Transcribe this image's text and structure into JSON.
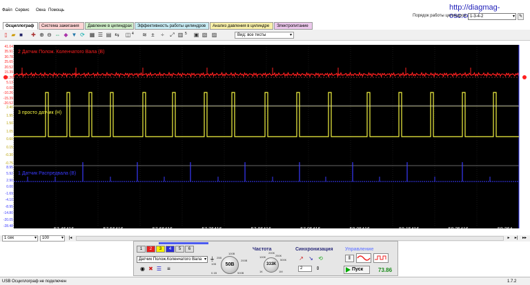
{
  "menu": [
    "Файл",
    "Сервис",
    "Окна",
    "Помощь"
  ],
  "url": "http://diagmag-osc.com/",
  "order": {
    "label": "Порядок работы цилиндров:",
    "value": "1-3-4-2"
  },
  "tabs": [
    {
      "label": "Осциллограф",
      "color": "#ffffff"
    },
    {
      "label": "Система зажигания",
      "color": "#ffd4d4"
    },
    {
      "label": "Давление в цилиндрах",
      "color": "#cfeec8"
    },
    {
      "label": "Эффективность работы цилиндров",
      "color": "#c8ecf4"
    },
    {
      "label": "Анализ давления в цилиндре",
      "color": "#f8f0a8"
    },
    {
      "label": "Электропитание",
      "color": "#ecc8ec"
    }
  ],
  "toolbar": {
    "counter1": "4",
    "counter2": "5",
    "view_select": "Вид: все тесты"
  },
  "channels": [
    {
      "label": "2 Датчик Полож. Коленчатого Вала (В)",
      "color": "#ff2020",
      "yticks": [
        "41.04",
        "35.91",
        "30.78",
        "25.65",
        "20.52",
        "15.39",
        "10.26",
        "5.13",
        "0.00",
        "-10.26",
        "-15.39",
        "-20.52"
      ]
    },
    {
      "label": "3 просто датчик (Н)",
      "color": "#f5f542",
      "yticks": [
        "2.40",
        "1.95",
        "1.50",
        "1.05",
        "0.60",
        "0.15",
        "-0.30",
        "-0.75"
      ]
    },
    {
      "label": "1 Датчик Распредвала (В)",
      "color": "#3a3aff",
      "yticks": [
        "8.95",
        "5.92",
        "2.90",
        "0.00",
        "-1.69",
        "-4.10",
        "-8.95",
        "-14.80",
        "-20.05",
        "-28.48"
      ]
    }
  ],
  "time_labels": [
    "57.46416",
    "57.56416",
    "57.66416",
    "57.76416",
    "57.86416",
    "57.95416",
    "58.05416",
    "58.15416",
    "58.25416",
    "58.364"
  ],
  "scroll": {
    "window_unit": "1 сек",
    "zoom": "100"
  },
  "controls": {
    "channel_buttons": [
      "1",
      "2",
      "3",
      "4",
      "5",
      "6"
    ],
    "active_channel_colors": [
      "#ff2020",
      "#f5f542",
      "#3a3aff"
    ],
    "sensor_select": "Датчик Полож.Коленчатого Вала",
    "knob1": {
      "value": "50В",
      "tick_labels": [
        "10В",
        "25В",
        "100В",
        "200В",
        "500В",
        "0.1В"
      ]
    },
    "freq_title": "Частота",
    "knob2": {
      "value": "333К",
      "tick_labels": [
        "200К",
        "100К",
        "500К",
        "1К",
        "1М",
        "2.5К",
        "250К"
      ]
    },
    "sync_title": "Синхронизация",
    "sync_channel": "2",
    "control_title": "Управление",
    "start_label": "Пуск",
    "fps": "73.86"
  },
  "status": {
    "text": "USB Осциллограф не подключен",
    "version": "1.7.2"
  }
}
